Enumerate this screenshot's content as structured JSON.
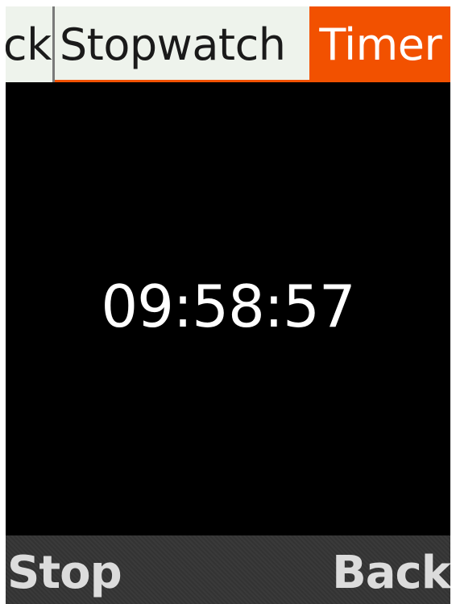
{
  "tabs": {
    "clock_label": "ck",
    "stopwatch_label": "Stopwatch",
    "timer_label": "Timer",
    "active": "Timer"
  },
  "timer": {
    "display": "09:58:57"
  },
  "softkeys": {
    "left_label": "Stop",
    "right_label": "Back"
  },
  "colors": {
    "accent": "#f25100",
    "tab_background": "#eef3ec",
    "screen_background": "#000000",
    "softkey_bar": "#363636"
  }
}
